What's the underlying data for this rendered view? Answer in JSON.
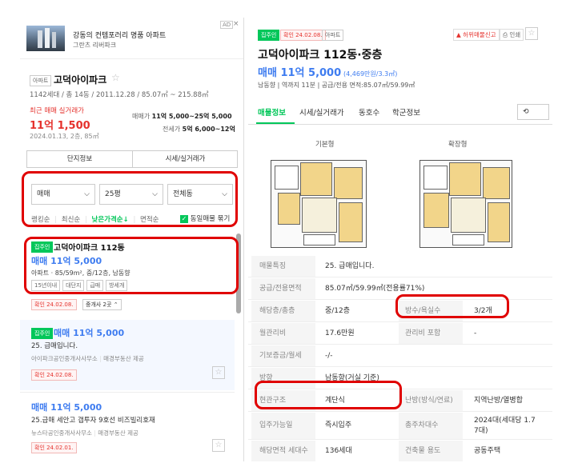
{
  "ad": {
    "title": "강동의 컨템포러리 명품 아파트",
    "subtitle": "그란츠 리버파크",
    "badge": "AD"
  },
  "complex": {
    "type_tag": "아파트",
    "name": "고덕아이파크",
    "info": "1142세대 / 총 14동 / 2011.12.28 / 85.07㎡ ~ 215.88㎡",
    "recent_label": "최근 매매 실거래가",
    "recent_price": "11억 1,500",
    "recent_date": "2024.01.13, 2층, 85㎡",
    "sale_label": "매매가",
    "sale_range": "11억 5,000~25억 5,000",
    "jeonse_label": "전세가",
    "jeonse_range": "5억 6,000~12억"
  },
  "tabs": [
    "단지정보",
    "시세/실거래가"
  ],
  "filters": {
    "trade": "매매",
    "size": "25평",
    "dong": "전체동"
  },
  "sort": {
    "options": [
      "랭킹순",
      "최신순",
      "낮은가격순↓",
      "면적순"
    ],
    "same_listing": "동일매물 묶기"
  },
  "listings": [
    {
      "badge": "집주인",
      "title": "고덕아이파크 112동",
      "price": "매매 11억 5,000",
      "desc": "아파트 · 85/59m², 중/12층, 남동향",
      "tags": [
        "15년이내",
        "대단지",
        "급매",
        "방세개"
      ],
      "confirm": "확인 24.02.08.",
      "agents": "중개사 2곳"
    },
    {
      "badge": "집주인",
      "price": "매매 11억 5,000",
      "desc": "25. 급매입니다.",
      "agency": "아이파크공인중개사사무소",
      "provider": "매경부동산 제공",
      "confirm": "확인 24.02.08."
    },
    {
      "price": "매매 11억 5,000",
      "desc": "25.급매 세안고 갭투자 9호선 비즈빌리호재",
      "agency": "뉴스타공인중개사사무소",
      "provider": "매경부동산 제공",
      "confirm": "확인 24.02.01."
    }
  ],
  "detail": {
    "owner_badge": "집주인",
    "confirm": "확인 24.02.08.",
    "type_tag": "아파트",
    "report": "허위매물신고",
    "print": "인쇄",
    "title": "고덕아이파크 112동·중층",
    "price": "매매 11억 5,000",
    "price_per": "(4,469만원/3.3㎡)",
    "summary": "남동향 | 역까지 11분 | 공급/전용 면적:85.07㎡/59.99㎡",
    "tabs": [
      "매물정보",
      "시세/실거래가",
      "동호수",
      "학군정보"
    ],
    "plan_basic": "기본형",
    "plan_ext": "확장형",
    "rows": [
      {
        "label": "매물특징",
        "value": "25. 급매입니다."
      },
      {
        "label": "공급/전용면적",
        "value": "85.07㎡/59.99㎡(전용률71%)"
      },
      {
        "label": "해당층/총층",
        "value": "중/12층",
        "label2": "방수/욕실수",
        "value2": "3/2개"
      },
      {
        "label": "월관리비",
        "value": "17.6만원",
        "label2": "관리비 포함",
        "value2": "-"
      },
      {
        "label": "기보증금/월세",
        "value": "-/-"
      },
      {
        "label": "방향",
        "value": "남동향(거실 기준)"
      },
      {
        "label": "현관구조",
        "value": "계단식",
        "label2": "난방(방식/연료)",
        "value2": "지역난방/열병합"
      },
      {
        "label": "입주가능일",
        "value": "즉시입주",
        "label2": "총주차대수",
        "value2": "2024대(세대당 1.7",
        "value2b": "7대)"
      },
      {
        "label": "해당면적 세대수",
        "value": "136세대",
        "label2": "건축물 용도",
        "value2": "공동주택"
      }
    ]
  },
  "colors": {
    "accent_green": "#03c75a",
    "price_blue": "#3e7cf0",
    "highlight_red": "#e00000"
  }
}
